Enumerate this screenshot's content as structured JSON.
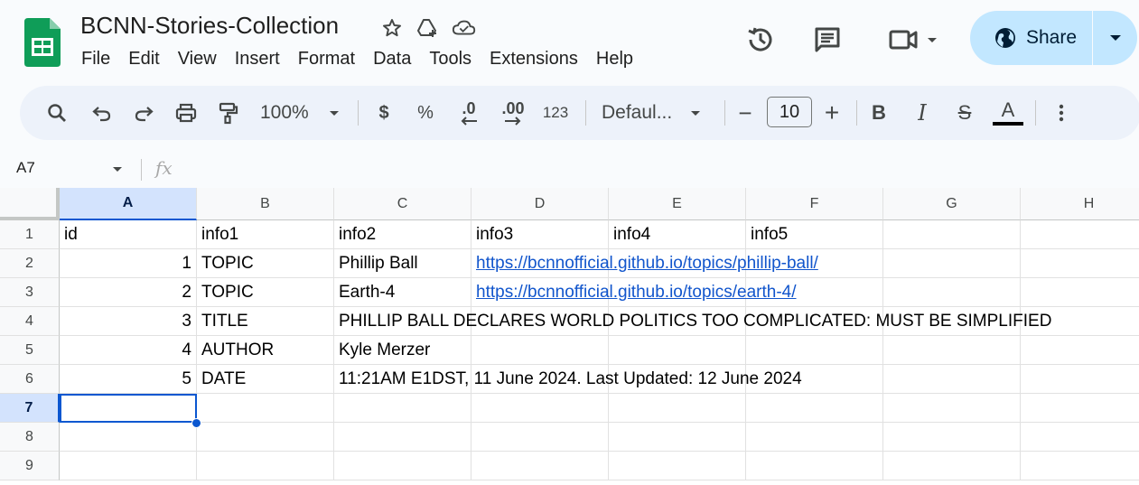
{
  "doc": {
    "title": "BCNN-Stories-Collection",
    "title_icons": [
      "star-icon",
      "move-to-drive-icon",
      "cloud-status-icon"
    ]
  },
  "menu": [
    "File",
    "Edit",
    "View",
    "Insert",
    "Format",
    "Data",
    "Tools",
    "Extensions",
    "Help"
  ],
  "share": {
    "label": "Share"
  },
  "toolbar": {
    "zoom": "100%",
    "currency": "$",
    "percent": "%",
    "decrease_decimal": ".0",
    "increase_decimal": ".00",
    "number_format": "123",
    "font": "Defaul...",
    "font_size": "10",
    "bold": "B",
    "italic": "I",
    "strike": "S",
    "text_color": "A",
    "minus": "−",
    "plus": "+"
  },
  "formula_bar": {
    "name_box": "A7",
    "fx": "fx"
  },
  "grid": {
    "columns": [
      "A",
      "B",
      "C",
      "D",
      "E",
      "F",
      "G",
      "H"
    ],
    "selected_column": "A",
    "rows": [
      "1",
      "2",
      "3",
      "4",
      "5",
      "6",
      "7",
      "8",
      "9"
    ],
    "selected_row": "7",
    "cells": {
      "r1": [
        "id",
        "info1",
        "info2",
        "info3",
        "info4",
        "info5"
      ],
      "r2": [
        "1",
        "TOPIC",
        "Phillip Ball",
        "https://bcnnofficial.github.io/topics/phillip-ball/"
      ],
      "r3": [
        "2",
        "TOPIC",
        "Earth-4",
        "https://bcnnofficial.github.io/topics/earth-4/"
      ],
      "r4": [
        "3",
        "TITLE",
        "PHILLIP BALL DECLARES WORLD POLITICS TOO COMPLICATED: MUST BE SIMPLIFIED"
      ],
      "r5": [
        "4",
        "AUTHOR",
        "Kyle Merzer"
      ],
      "r6": [
        "5",
        "DATE",
        "11:21AM E1DST, 11 June 2024. Last Updated: 12 June 2024"
      ]
    }
  },
  "colors": {
    "accent": "#0b57d0",
    "share_bg": "#c2e7ff",
    "toolbar_bg": "#edf2fa",
    "link": "#1155cc",
    "sheets_green": "#0f9d58"
  }
}
